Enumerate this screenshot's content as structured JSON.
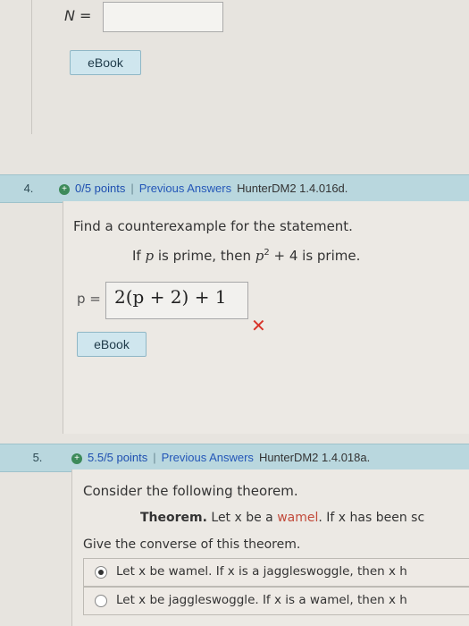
{
  "question3": {
    "n_label": "N =",
    "ebook_label": "eBook"
  },
  "question4": {
    "number": "4.",
    "points": "0/5 points",
    "separator": "|",
    "previous_answers": "Previous Answers",
    "code": "HunterDM2 1.4.016d.",
    "prompt": "Find a counterexample for the statement.",
    "statement_prefix": "If ",
    "statement_var": "p",
    "statement_mid": " is prime, then ",
    "statement_var2": "p",
    "statement_exp": "2",
    "statement_suffix": " + 4  is prime.",
    "answer_label": "p =",
    "answer_value": "2(p + 2) + 1",
    "result": "incorrect",
    "ebook_label": "eBook"
  },
  "question5": {
    "number": "5.",
    "points": "5.5/5 points",
    "separator": "|",
    "previous_answers": "Previous Answers",
    "code": "HunterDM2 1.4.018a.",
    "prompt": "Consider the following theorem.",
    "theorem_label": "Theorem.",
    "theorem_text_1": " Let x be a ",
    "theorem_word": "wamel",
    "theorem_text_2": ". If x has been sc",
    "question": "Give the converse of this theorem.",
    "options": [
      {
        "label": "Let x be wamel. If x is a jaggleswoggle, then x h",
        "selected": true
      },
      {
        "label": "Let x be jaggleswoggle. If x is a wamel, then x h",
        "selected": false
      }
    ]
  },
  "colors": {
    "header_bar": "#b9d7de",
    "points_link": "#1e4fb0",
    "wrong_mark": "#d8342a",
    "ebook_button": "#cfe6ee"
  }
}
